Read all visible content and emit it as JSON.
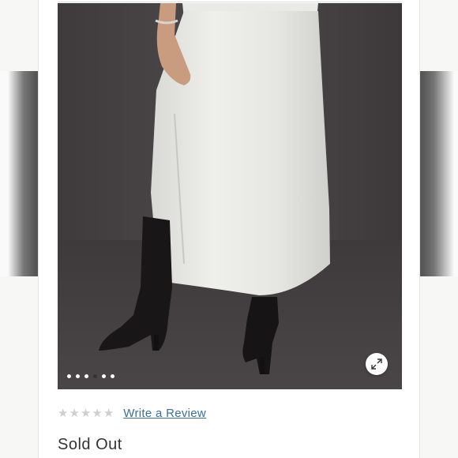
{
  "product": {
    "image_alt": "Model wearing a white midi skirt with black suede boots",
    "carousel": {
      "total": 6,
      "active_index": 3
    },
    "expand_icon": "expand-arrows-icon"
  },
  "review": {
    "stars": [
      "★",
      "★",
      "★",
      "★",
      "★"
    ],
    "rating": 0,
    "link_label": "Write a Review"
  },
  "availability": {
    "status": "Sold Out"
  },
  "colors": {
    "link": "#3a6f9a",
    "star_empty": "#cfcfcf",
    "image_bg": "#4b4749"
  }
}
